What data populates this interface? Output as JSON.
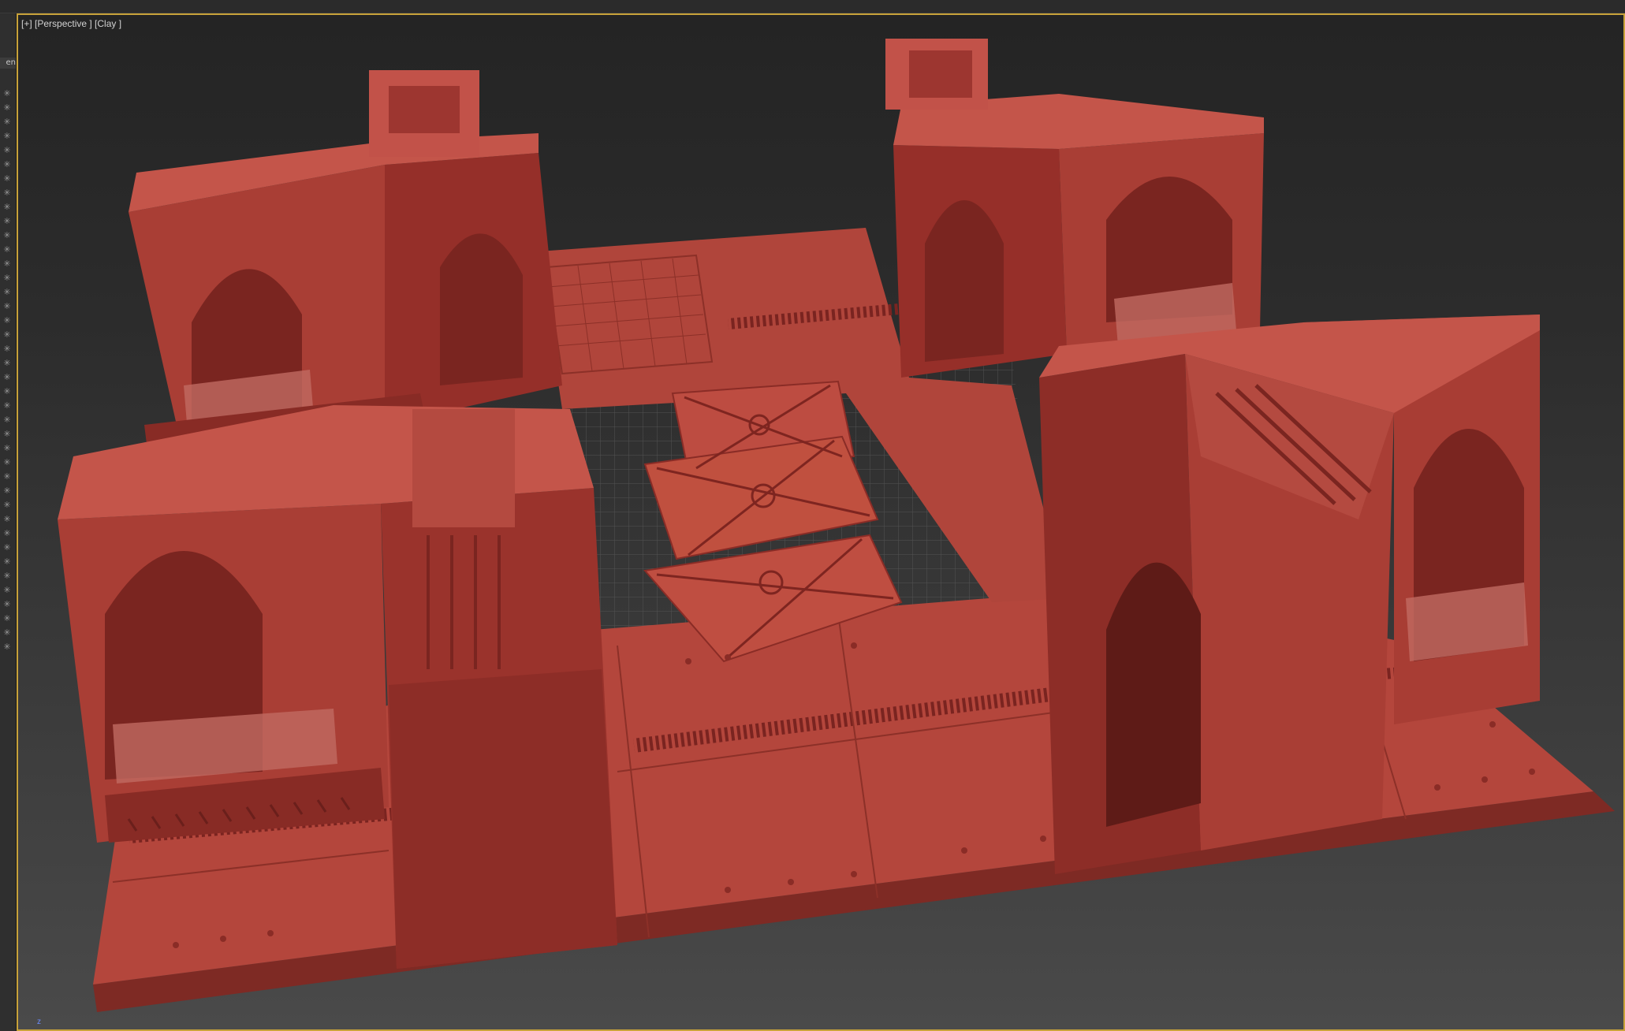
{
  "viewport": {
    "label": "[+] [Perspective ] [Clay ]",
    "axis_label": "z"
  },
  "left_panel": {
    "tab_label": "en",
    "icon_name": "snowflake-freeze-icon"
  },
  "colors": {
    "clay": "#b8483e",
    "clay_dark": "#8a2c26",
    "clay_light": "#c9584c",
    "viewport_border": "#c8a23a",
    "background": "#2c2c2c"
  }
}
